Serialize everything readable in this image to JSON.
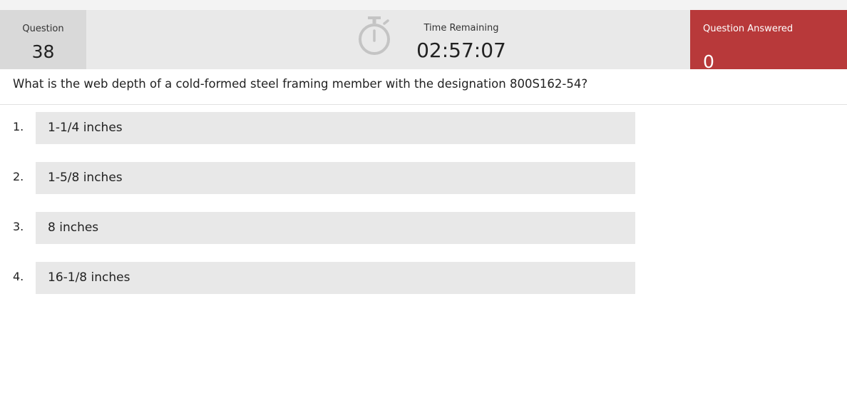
{
  "header": {
    "question_label": "Question",
    "question_number": "38",
    "time_label": "Time Remaining",
    "time_value": "02:57:07",
    "answered_label": "Question Answered",
    "answered_count": "0"
  },
  "question": {
    "text": "What is the web depth of a cold-formed steel framing member with the designation 800S162-54?"
  },
  "answers": [
    {
      "number": "1.",
      "text": "1-1/4 inches"
    },
    {
      "number": "2.",
      "text": "1-5/8 inches"
    },
    {
      "number": "3.",
      "text": "8 inches"
    },
    {
      "number": "4.",
      "text": "16-1/8 inches"
    }
  ],
  "icons": {
    "timer": "stopwatch-icon"
  },
  "colors": {
    "answered_bg": "#b8393a",
    "header_bg": "#e9e9e9",
    "question_box_bg": "#d9d9d9",
    "option_bg": "#e8e8e8"
  }
}
